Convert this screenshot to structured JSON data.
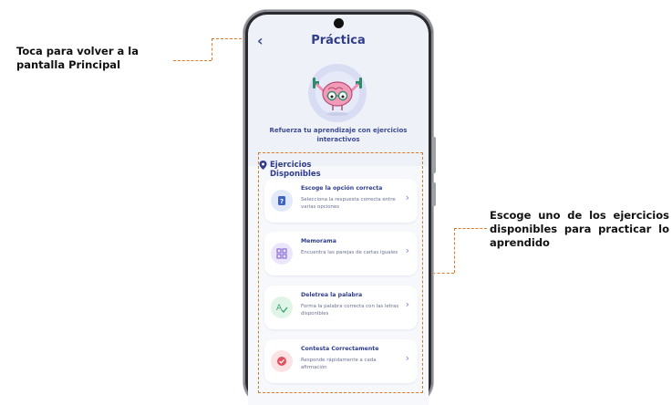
{
  "annotations": {
    "left": "Toca para volver a la pantalla Principal",
    "right": "Escoge uno de los ejercicios disponibles para practicar lo aprendido"
  },
  "colors": {
    "accent": "#2f3d8a",
    "annotation_dash": "#e07a28",
    "screen_bg": "#eef1f8"
  },
  "screen": {
    "back_icon": "chevron-left-icon",
    "title": "Práctica",
    "subtitle": "Refuerza tu aprendizaje con ejercicios interactivos",
    "mascot_icon": "brain-mascot-icon"
  },
  "exercises": {
    "section_icon": "location-pin-icon",
    "title": "Ejercicios Disponibles",
    "items": [
      {
        "title": "Escoge la opción correcta",
        "description": "Selecciona la respuesta correcta entre varias opciones",
        "icon": "question-card-icon"
      },
      {
        "title": "Memorama",
        "description": "Encuentra las parejas de cartas iguales",
        "icon": "grid-icon"
      },
      {
        "title": "Deletrea la palabra",
        "description": "Forma la palabra correcta con las letras disponibles",
        "icon": "spell-check-icon"
      },
      {
        "title": "Contesta Correctamente",
        "description": "Responde rápidamente a cada afirmación",
        "icon": "check-circle-icon"
      }
    ]
  }
}
